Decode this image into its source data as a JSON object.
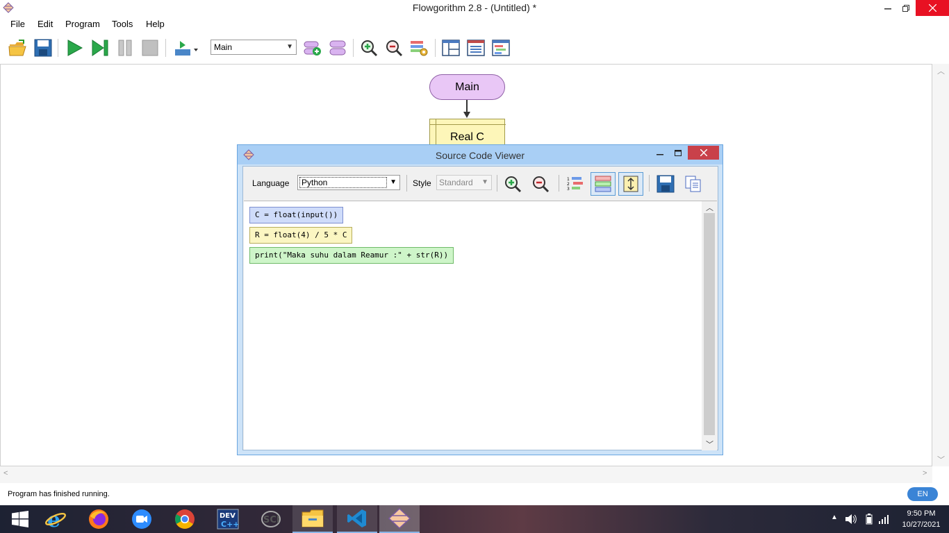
{
  "window": {
    "title": "Flowgorithm 2.8 - (Untitled) *"
  },
  "menu": {
    "items": [
      "File",
      "Edit",
      "Program",
      "Tools",
      "Help"
    ]
  },
  "toolbar": {
    "function_select": "Main"
  },
  "flowchart": {
    "start_label": "Main",
    "declare_label": "Real C"
  },
  "source_viewer": {
    "title": "Source Code Viewer",
    "language_label": "Language",
    "language_value": "Python",
    "style_label": "Style",
    "style_value": "Standard",
    "code_lines": [
      "C = float(input())",
      "R = float(4) / 5 * C",
      "print(\"Maka suhu dalam Reamur :\" + str(R))"
    ]
  },
  "status": {
    "message": "Program has finished running.",
    "language_indicator": "EN"
  },
  "taskbar": {
    "apps": [
      "start-icon",
      "internet-explorer-icon",
      "firefox-icon",
      "zoom-icon",
      "chrome-icon",
      "dev-cpp-icon",
      "scilab-icon",
      "file-explorer-icon",
      "vscode-icon",
      "flowgorithm-icon"
    ],
    "clock_time": "9:50 PM",
    "clock_date": "10/27/2021"
  },
  "colors": {
    "start_node": "#e9c7f6",
    "declare_node": "#fdf6b9",
    "code_line_1": "#cfdcfa",
    "code_line_2": "#fbf6c2",
    "code_line_3": "#cef5c9",
    "dialog_title": "#a9cff5"
  }
}
